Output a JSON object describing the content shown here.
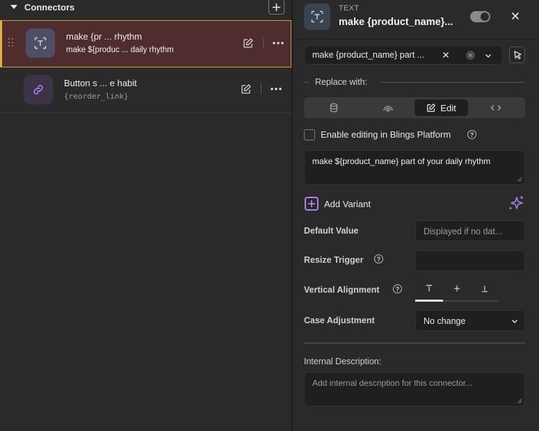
{
  "left_panel": {
    "section_title": "Connectors",
    "add_icon": "plus-icon",
    "rows": [
      {
        "name": "make {pr ... rhythm",
        "subtitle": "make ${produc ... daily rhythm",
        "icon": "text-frame-icon",
        "selected": true
      },
      {
        "name": "Button s ... e habit",
        "subtitle": "{reorder_link}",
        "icon": "link-icon",
        "selected": false
      }
    ]
  },
  "right_panel": {
    "type_label": "TEXT",
    "title": "make {product_name}...",
    "toggle_on": true,
    "layer_select": {
      "value": "make {product_name} part ..."
    },
    "replace_label": "Replace with:",
    "tabs": {
      "edit_label": "Edit"
    },
    "enable_editing_label": "Enable editing in Blings Platform",
    "text_value": "make ${product_name} part of your daily rhythm",
    "add_variant_label": "Add Variant",
    "default_value": {
      "label": "Default Value",
      "placeholder": "Displayed if no dat..."
    },
    "resize_trigger": {
      "label": "Resize Trigger"
    },
    "vertical_alignment": {
      "label": "Vertical Alignment",
      "selected": "top"
    },
    "case_adjustment": {
      "label": "Case Adjustment",
      "value": "No change"
    },
    "internal_description": {
      "label": "Internal Description:",
      "placeholder": "Add internal description for this connector..."
    }
  },
  "colors": {
    "selected_row_bg": "#4f2d2f",
    "selected_row_border": "#d9b144",
    "accent_purple": "#b084f0",
    "panel_bg": "#2a2a2a",
    "field_bg": "#1f1f1f"
  }
}
